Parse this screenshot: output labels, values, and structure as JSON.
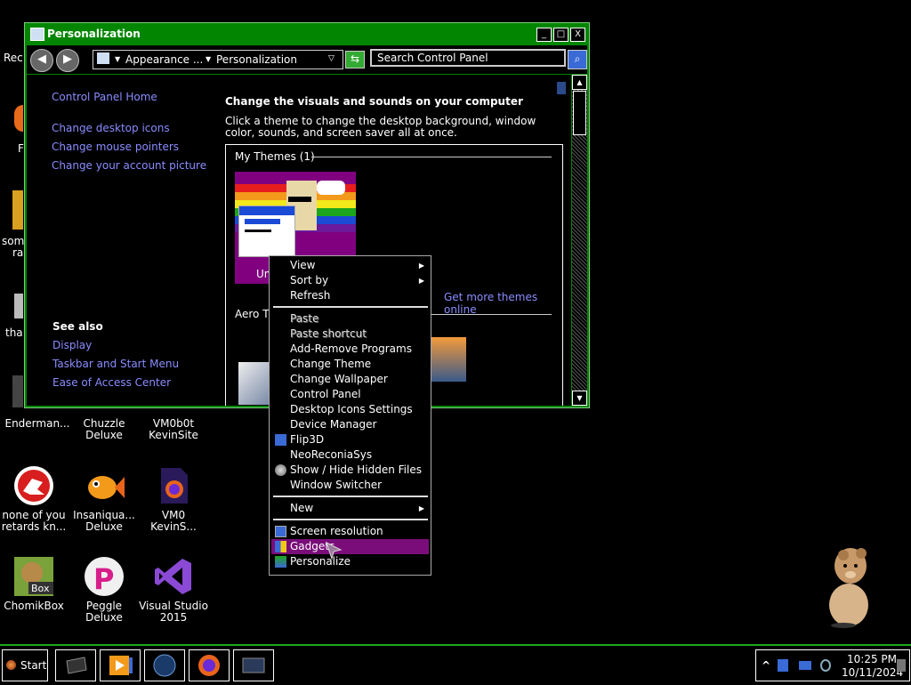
{
  "desktop": {
    "clipped_labels": [
      "Rec",
      "F",
      "some",
      "ra",
      "tha"
    ],
    "icons": [
      {
        "label": "Enderman..."
      },
      {
        "label": "Chuzzle\nDeluxe"
      },
      {
        "label": "VM0b0t\nKevinSite"
      },
      {
        "label": "none of you\nretards kn..."
      },
      {
        "label": "Insaniqua...\nDeluxe"
      },
      {
        "label": "VM0\nKevinS..."
      },
      {
        "label": "ChomikBox"
      },
      {
        "label": "Peggle\nDeluxe"
      },
      {
        "label": "Visual Studio\n2015"
      }
    ]
  },
  "window": {
    "title": "Personalization",
    "controls": {
      "minimize": "_",
      "maximize": "□",
      "close": "X"
    },
    "breadcrumb": [
      "Appearance ...",
      "Personalization"
    ],
    "search_placeholder": "Search Control Panel",
    "sidebar": {
      "home": "Control Panel Home",
      "links": [
        "Change desktop icons",
        "Change mouse pointers",
        "Change your account picture"
      ],
      "see_also_title": "See also",
      "see_also": [
        "Display",
        "Taskbar and Start Menu",
        "Ease of Access Center"
      ]
    },
    "main": {
      "heading": "Change the visuals and sounds on your computer",
      "description": "Click a theme to change the desktop background, window color, sounds, and screen saver all at once.",
      "my_themes_label": "My Themes (1)",
      "theme_name_partial": "Un",
      "get_more_link": "Get more themes online",
      "aero_label_partial": "Aero Th"
    }
  },
  "context_menu": {
    "items": [
      {
        "label": "View",
        "submenu": true
      },
      {
        "label": "Sort by",
        "submenu": true
      },
      {
        "label": "Refresh"
      },
      {
        "sep": true
      },
      {
        "label": "Paste",
        "disabled": true
      },
      {
        "label": "Paste shortcut",
        "disabled": true
      },
      {
        "label": "Add-Remove Programs"
      },
      {
        "label": "Change Theme"
      },
      {
        "label": "Change Wallpaper"
      },
      {
        "label": "Control Panel"
      },
      {
        "label": "Desktop Icons Settings"
      },
      {
        "label": "Device Manager"
      },
      {
        "label": "Flip3D",
        "icon": "flip3d-icon"
      },
      {
        "label": "NeoReconiaSys"
      },
      {
        "label": "Show / Hide Hidden Files",
        "icon": "shield-icon"
      },
      {
        "label": "Window Switcher"
      },
      {
        "sep": true
      },
      {
        "label": "New",
        "submenu": true
      },
      {
        "sep": true
      },
      {
        "label": "Screen resolution",
        "icon": "screen-resolution-icon"
      },
      {
        "label": "Gadgets",
        "icon": "gadgets-icon",
        "highlighted": true
      },
      {
        "label": "Personalize",
        "icon": "personalize-icon"
      }
    ]
  },
  "taskbar": {
    "start_label": "Start",
    "clock_time": "10:25 PM",
    "clock_date": "10/11/2024",
    "tray_chevron": "^"
  },
  "colors": {
    "window_frame": "#028602",
    "link": "#8a8cff",
    "menu_highlight": "#7a0d7a",
    "taskbar_border": "#1ea51e"
  }
}
